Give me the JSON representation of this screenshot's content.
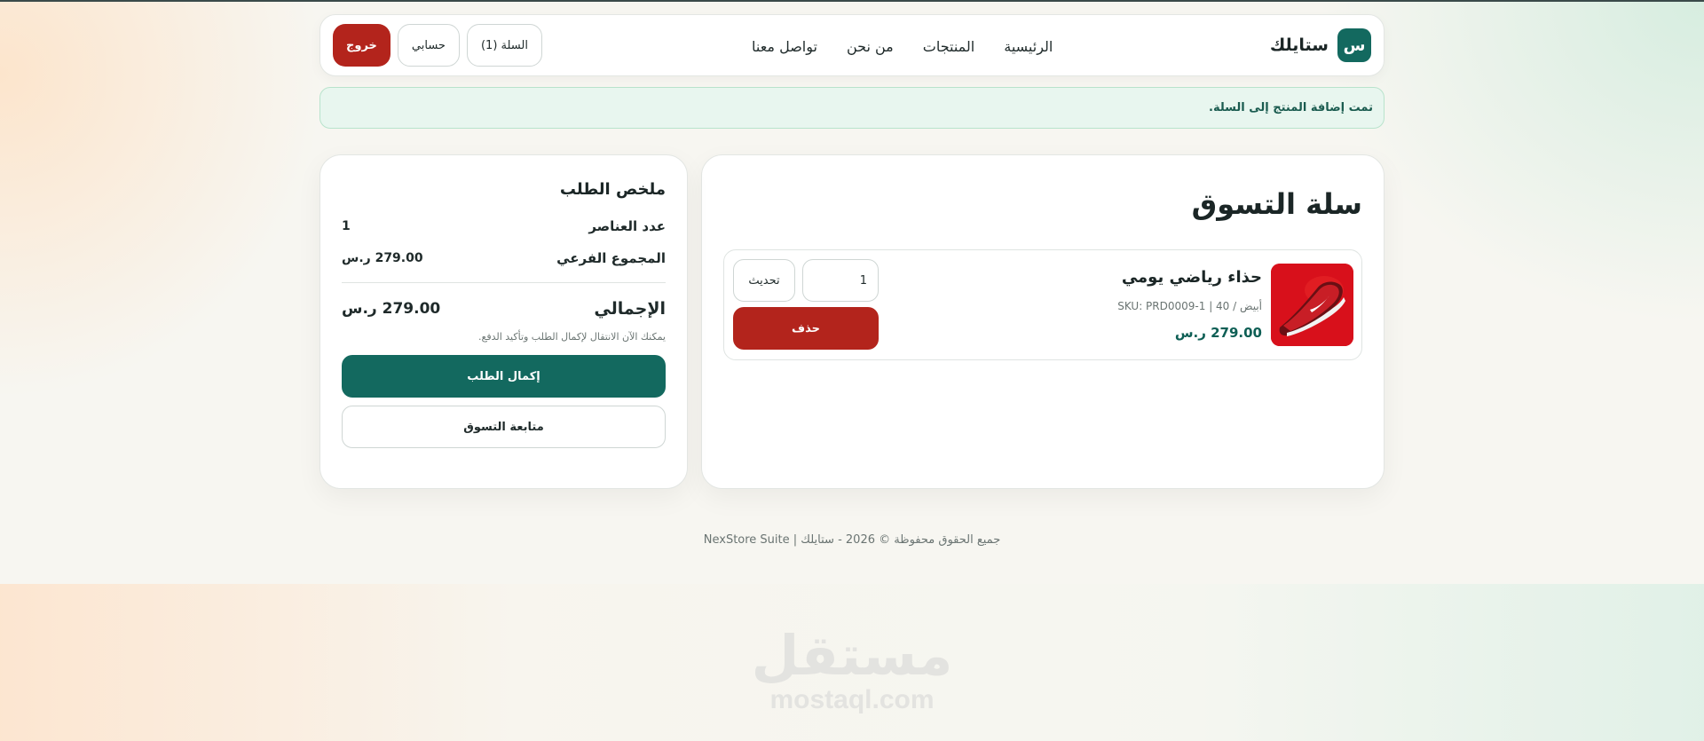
{
  "header": {
    "brand_logo": "س",
    "brand_name": "ستايلك",
    "nav": [
      "الرئيسية",
      "المنتجات",
      "من نحن",
      "تواصل معنا"
    ],
    "cart_label": "السلة (1)",
    "account_label": "حسابي",
    "logout_label": "خروج"
  },
  "flash": {
    "message": "تمت إضافة المنتج إلى السلة."
  },
  "cart": {
    "title": "سلة التسوق",
    "item": {
      "name": "حذاء رياضي يومي",
      "meta": "أبيض / 40 | SKU: PRD0009-1",
      "price": "279.00 ر.س",
      "quantity": "1",
      "update_label": "تحديث",
      "delete_label": "حذف"
    }
  },
  "summary": {
    "title": "ملخص الطلب",
    "items_label": "عدد العناصر",
    "items_value": "1",
    "subtotal_label": "المجموع الفرعي",
    "subtotal_value": "279.00 ر.س",
    "total_label": "الإجمالي",
    "total_value": "279.00 ر.س",
    "note": "يمكنك الآن الانتقال لإكمال الطلب وتأكيد الدفع.",
    "checkout_label": "إكمال الطلب",
    "continue_label": "متابعة التسوق"
  },
  "footer": {
    "text": "جميع الحقوق محفوظة © 2026 - ستايلك | NexStore Suite"
  },
  "watermark": {
    "arabic": "مستقل",
    "latin": "mostaql.com"
  },
  "colors": {
    "brand": "#13695f",
    "danger": "#b3241c",
    "flash_bg": "#e8f6ef"
  }
}
